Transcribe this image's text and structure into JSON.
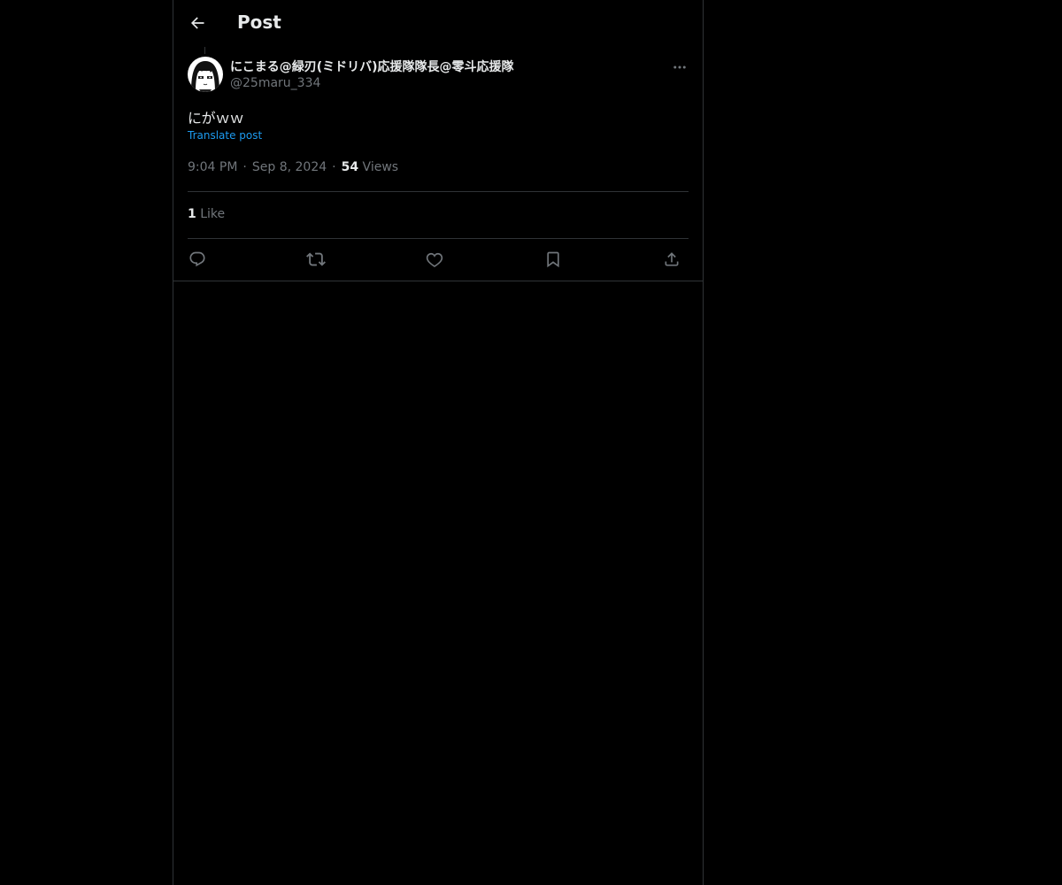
{
  "header": {
    "back_icon": "arrow-left-icon",
    "title": "Post"
  },
  "post": {
    "author": {
      "display_name": "にこまる@緑刃(ミドリバ)応援隊隊長@零斗応援隊",
      "handle": "@25maru_334",
      "avatar_icon": "anime-character-avatar"
    },
    "more_icon": "more-horizontal-icon",
    "text": "にがｗｗ",
    "translate_label": "Translate post",
    "time": "9:04 PM",
    "date": "Sep 8, 2024",
    "views_count": "54",
    "views_label": "Views",
    "likes_count": "1",
    "likes_label": "Like",
    "separator": "·"
  },
  "actions": [
    {
      "name": "reply",
      "icon": "reply-icon"
    },
    {
      "name": "repost",
      "icon": "repost-icon"
    },
    {
      "name": "like",
      "icon": "heart-icon"
    },
    {
      "name": "bookmark",
      "icon": "bookmark-icon"
    },
    {
      "name": "share",
      "icon": "share-icon"
    }
  ],
  "colors": {
    "background": "#000000",
    "text_primary": "#e7e9ea",
    "text_secondary": "#71767b",
    "accent": "#1d9bf0",
    "border": "#2f3336"
  }
}
